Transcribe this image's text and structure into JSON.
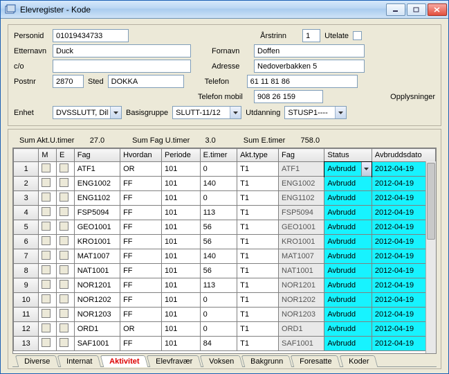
{
  "window": {
    "title": "Elevregister - Kode"
  },
  "form": {
    "personid_label": "Personid",
    "personid": "01019434733",
    "arstrinn_label": "Årstrinn",
    "arstrinn": "1",
    "utelate_label": "Utelate",
    "etternavn_label": "Etternavn",
    "etternavn": "Duck",
    "fornavn_label": "Fornavn",
    "fornavn": "Doffen",
    "co_label": "c/o",
    "co": "",
    "adresse_label": "Adresse",
    "adresse": "Nedoverbakken 5",
    "postnr_label": "Postnr",
    "postnr": "2870",
    "sted_label": "Sted",
    "sted": "DOKKA",
    "telefon_label": "Telefon",
    "telefon": "61 11 81 86",
    "telefon_mobil_label": "Telefon mobil",
    "telefon_mobil": "908 26 159",
    "opplysninger_label": "Opplysninger",
    "enhet_label": "Enhet",
    "enhet": "DVSSLUTT, Dille",
    "basisgruppe_label": "Basisgruppe",
    "basisgruppe": "SLUTT-11/12",
    "utdanning_label": "Utdanning",
    "utdanning": "STUSP1----"
  },
  "sums": {
    "akt_label": "Sum Akt.U.timer",
    "akt": "27.0",
    "fag_label": "Sum Fag U.timer",
    "fag": "3.0",
    "e_label": "Sum E.timer",
    "e": "758.0"
  },
  "columns": [
    "",
    "M",
    "E",
    "Fag",
    "Hvordan",
    "Periode",
    "E.timer",
    "Akt.type",
    "Fag",
    "Status",
    "Avbruddsdato"
  ],
  "rows": [
    {
      "n": "1",
      "fag": "ATF1",
      "hvordan": "OR",
      "periode": "101",
      "etimer": "0",
      "akt": "T1",
      "fag2": "ATF1",
      "status": "Avbrudd",
      "dato": "2012-04-19",
      "sel": true
    },
    {
      "n": "2",
      "fag": "ENG1002",
      "hvordan": "FF",
      "periode": "101",
      "etimer": "140",
      "akt": "T1",
      "fag2": "ENG1002",
      "status": "Avbrudd",
      "dato": "2012-04-19"
    },
    {
      "n": "3",
      "fag": "ENG1102",
      "hvordan": "FF",
      "periode": "101",
      "etimer": "0",
      "akt": "T1",
      "fag2": "ENG1102",
      "status": "Avbrudd",
      "dato": "2012-04-19"
    },
    {
      "n": "4",
      "fag": "FSP5094",
      "hvordan": "FF",
      "periode": "101",
      "etimer": "113",
      "akt": "T1",
      "fag2": "FSP5094",
      "status": "Avbrudd",
      "dato": "2012-04-19"
    },
    {
      "n": "5",
      "fag": "GEO1001",
      "hvordan": "FF",
      "periode": "101",
      "etimer": "56",
      "akt": "T1",
      "fag2": "GEO1001",
      "status": "Avbrudd",
      "dato": "2012-04-19"
    },
    {
      "n": "6",
      "fag": "KRO1001",
      "hvordan": "FF",
      "periode": "101",
      "etimer": "56",
      "akt": "T1",
      "fag2": "KRO1001",
      "status": "Avbrudd",
      "dato": "2012-04-19"
    },
    {
      "n": "7",
      "fag": "MAT1007",
      "hvordan": "FF",
      "periode": "101",
      "etimer": "140",
      "akt": "T1",
      "fag2": "MAT1007",
      "status": "Avbrudd",
      "dato": "2012-04-19"
    },
    {
      "n": "8",
      "fag": "NAT1001",
      "hvordan": "FF",
      "periode": "101",
      "etimer": "56",
      "akt": "T1",
      "fag2": "NAT1001",
      "status": "Avbrudd",
      "dato": "2012-04-19"
    },
    {
      "n": "9",
      "fag": "NOR1201",
      "hvordan": "FF",
      "periode": "101",
      "etimer": "113",
      "akt": "T1",
      "fag2": "NOR1201",
      "status": "Avbrudd",
      "dato": "2012-04-19"
    },
    {
      "n": "10",
      "fag": "NOR1202",
      "hvordan": "FF",
      "periode": "101",
      "etimer": "0",
      "akt": "T1",
      "fag2": "NOR1202",
      "status": "Avbrudd",
      "dato": "2012-04-19"
    },
    {
      "n": "11",
      "fag": "NOR1203",
      "hvordan": "FF",
      "periode": "101",
      "etimer": "0",
      "akt": "T1",
      "fag2": "NOR1203",
      "status": "Avbrudd",
      "dato": "2012-04-19"
    },
    {
      "n": "12",
      "fag": "ORD1",
      "hvordan": "OR",
      "periode": "101",
      "etimer": "0",
      "akt": "T1",
      "fag2": "ORD1",
      "status": "Avbrudd",
      "dato": "2012-04-19"
    },
    {
      "n": "13",
      "fag": "SAF1001",
      "hvordan": "FF",
      "periode": "101",
      "etimer": "84",
      "akt": "T1",
      "fag2": "SAF1001",
      "status": "Avbrudd",
      "dato": "2012-04-19"
    }
  ],
  "tabs": {
    "items": [
      "Diverse",
      "Internat",
      "Aktivitet",
      "Elevfravær",
      "Voksen",
      "Bakgrunn",
      "Foresatte",
      "Koder"
    ],
    "selected": "Aktivitet"
  }
}
